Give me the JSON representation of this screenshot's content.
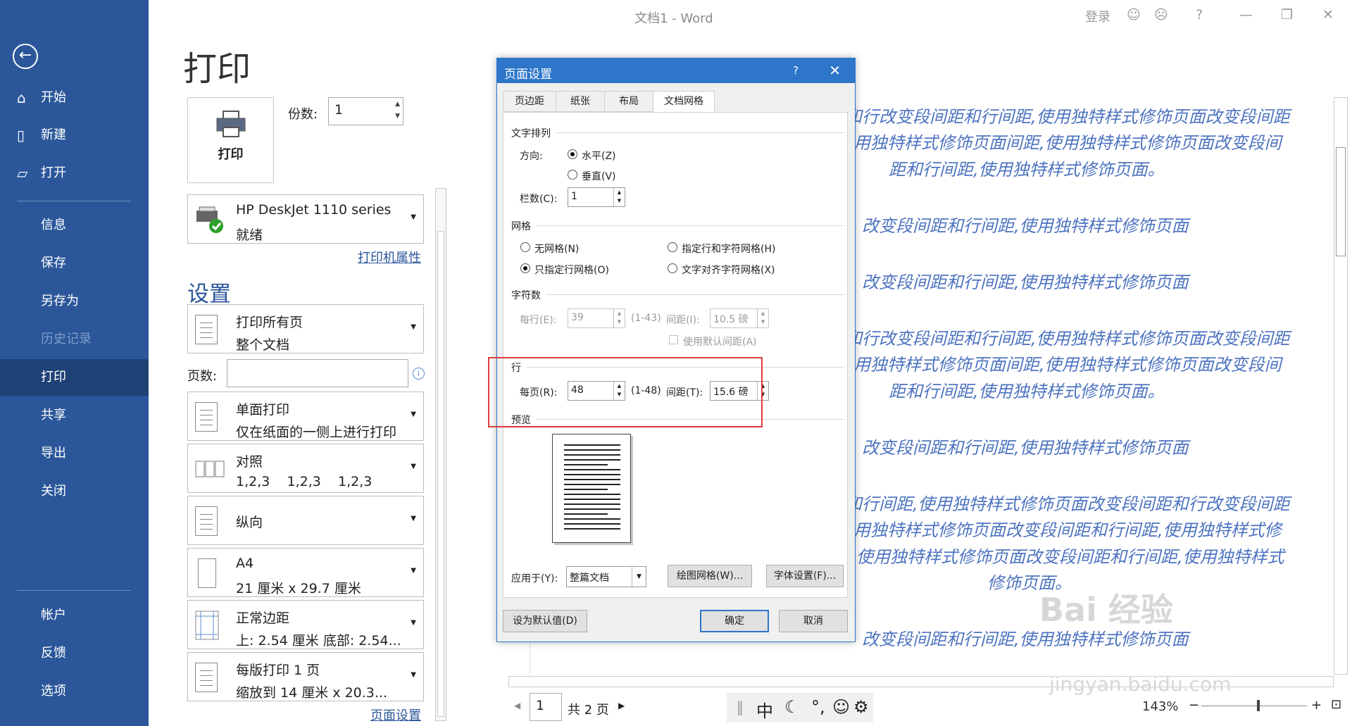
{
  "window": {
    "title": "文档1  -  Word",
    "login": "登录",
    "help": "?"
  },
  "sidebar": {
    "items": [
      {
        "label": "开始",
        "icon": "home-icon"
      },
      {
        "label": "新建",
        "icon": "new-doc-icon"
      },
      {
        "label": "打开",
        "icon": "open-folder-icon"
      },
      {
        "label": "信息"
      },
      {
        "label": "保存"
      },
      {
        "label": "另存为"
      },
      {
        "label": "历史记录"
      },
      {
        "label": "打印"
      },
      {
        "label": "共享"
      },
      {
        "label": "导出"
      },
      {
        "label": "关闭"
      },
      {
        "label": "帐户"
      },
      {
        "label": "反馈"
      },
      {
        "label": "选项"
      }
    ]
  },
  "print": {
    "heading": "打印",
    "button": "打印",
    "copies_label": "份数:",
    "copies_value": "1",
    "printer_name": "HP DeskJet 1110 series",
    "printer_status": "就绪",
    "printer_props": "打印机属性",
    "settings_heading": "设置",
    "pages_label": "页数:",
    "page_setup_link": "页面设置",
    "settings": [
      {
        "l1": "打印所有页",
        "l2": "整个文档"
      },
      {
        "l1": "单面打印",
        "l2": "仅在纸面的一侧上进行打印"
      },
      {
        "l1": "对照",
        "l2": "1,2,3    1,2,3    1,2,3"
      },
      {
        "l1": "纵向",
        "l2": ""
      },
      {
        "l1": "A4",
        "l2": "21 厘米 x 29.7 厘米"
      },
      {
        "l1": "正常边距",
        "l2": "上: 2.54 厘米 底部: 2.54..."
      },
      {
        "l1": "每版打印 1 页",
        "l2": "缩放到 14 厘米 x 20.3..."
      }
    ]
  },
  "preview": {
    "lines": [
      "和行改变段间距和行间距,使用独特样式修饰页面改变段间距",
      "用独特样式修饰页面间距,使用独特样式修饰页面改变段间",
      "距和行间距,使用独特样式修饰页面。",
      "改变段间距和行间距,使用独特样式修饰页面",
      "改变段间距和行间距,使用独特样式修饰页面",
      "和行改变段间距和行间距,使用独特样式修饰页面改变段间距",
      "用独特样式修饰页面间距,使用独特样式修饰页面改变段间",
      "距和行间距,使用独特样式修饰页面。",
      "改变段间距和行间距,使用独特样式修饰页面",
      "和行间距,使用独特样式修饰页面改变段间距和行改变段间距",
      "用独特样式修饰页面改变段间距和行间距,使用独特样式修",
      "使用独特样式修饰页面改变段间距和行间距,使用独特样式",
      "修饰页面。",
      "改变段间距和行间距,使用独特样式修饰页面"
    ],
    "current_page": "1",
    "total_pages": "共 2 页",
    "zoom": "143%",
    "ime": "中"
  },
  "dialog": {
    "title": "页面设置",
    "help": "?",
    "tabs": [
      "页边距",
      "纸张",
      "布局",
      "文档网格"
    ],
    "text_arrange": "文字排列",
    "direction_label": "方向:",
    "horizontal": "水平(Z)",
    "vertical": "垂直(V)",
    "columns_label": "栏数(C):",
    "columns_value": "1",
    "grid_heading": "网格",
    "no_grid": "无网格(N)",
    "line_char_grid": "指定行和字符网格(H)",
    "line_grid_only": "只指定行网格(O)",
    "text_snap_grid": "文字对齐字符网格(X)",
    "chars_heading": "字符数",
    "per_line_label": "每行(E):",
    "per_line_value": "39",
    "per_line_range": "(1-43)",
    "char_pitch_label": "间距(I):",
    "char_pitch_value": "10.5 磅",
    "default_pitch": "使用默认间距(A)",
    "lines_heading": "行",
    "per_page_label": "每页(R):",
    "per_page_value": "48",
    "per_page_range": "(1-48)",
    "line_pitch_label": "间距(T):",
    "line_pitch_value": "15.6 磅",
    "preview_heading": "预览",
    "apply_label": "应用于(Y):",
    "apply_value": "整篇文档",
    "draw_grid": "绘图网格(W)...",
    "font_settings": "字体设置(F)...",
    "set_default": "设为默认值(D)",
    "ok": "确定",
    "cancel": "取消"
  },
  "watermark": {
    "brand": "Bai  经验",
    "url": "jingyan.baidu.com"
  }
}
